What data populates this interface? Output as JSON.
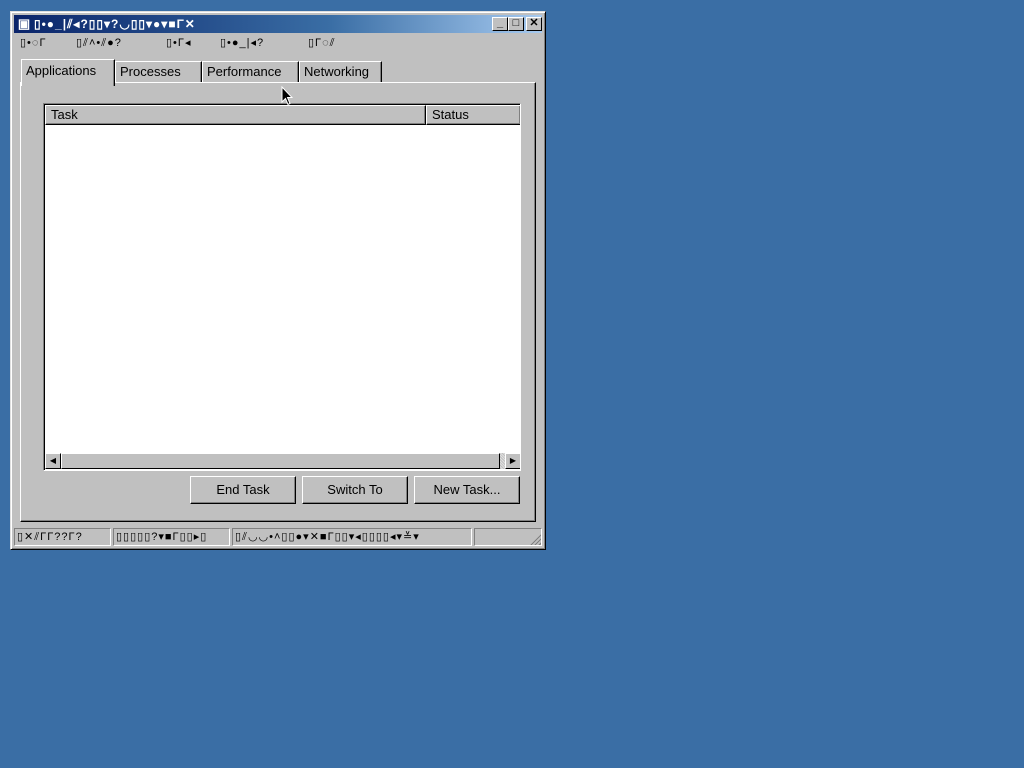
{
  "window": {
    "title": "▯•●_|⫽◂?▯▯▾?◡▯▯▾●▾■Γ✕",
    "app_icon": "monitor-icon",
    "controls": {
      "minimize": "_",
      "maximize": "□",
      "close": "✕"
    }
  },
  "menubar": {
    "items": [
      {
        "label": "▯•◌Γ"
      },
      {
        "label": "▯⫽˄•⫽●?"
      },
      {
        "label": "▯•Γ◂"
      },
      {
        "label": "▯•●_|◂?"
      },
      {
        "label": "▯Γ◌⫽"
      }
    ]
  },
  "tabs": [
    {
      "label": "Applications",
      "active": true
    },
    {
      "label": "Processes",
      "active": false
    },
    {
      "label": "Performance",
      "active": false
    },
    {
      "label": "Networking",
      "active": false
    }
  ],
  "task_list": {
    "columns": [
      {
        "label": "Task"
      },
      {
        "label": "Status"
      }
    ],
    "rows": []
  },
  "buttons": {
    "end_task": "End Task",
    "switch_to": "Switch To",
    "new_task": "New Task..."
  },
  "statusbar": {
    "panes": [
      {
        "text": "▯✕⫽ΓΓ??Γ?"
      },
      {
        "text": "▯▯▯▯▯?▾■Γ▯▯▸▯"
      },
      {
        "text": "▯⫽◡◡•˄▯▯●▾✕■Γ▯▯▾◂▯▯▯▯◂▾≚▾"
      },
      {
        "text": ""
      }
    ]
  },
  "colors": {
    "desktop": "#3a6ea5",
    "titlebar_start": "#0a246a",
    "titlebar_end": "#a6caf0",
    "face": "#c0c0c0"
  }
}
